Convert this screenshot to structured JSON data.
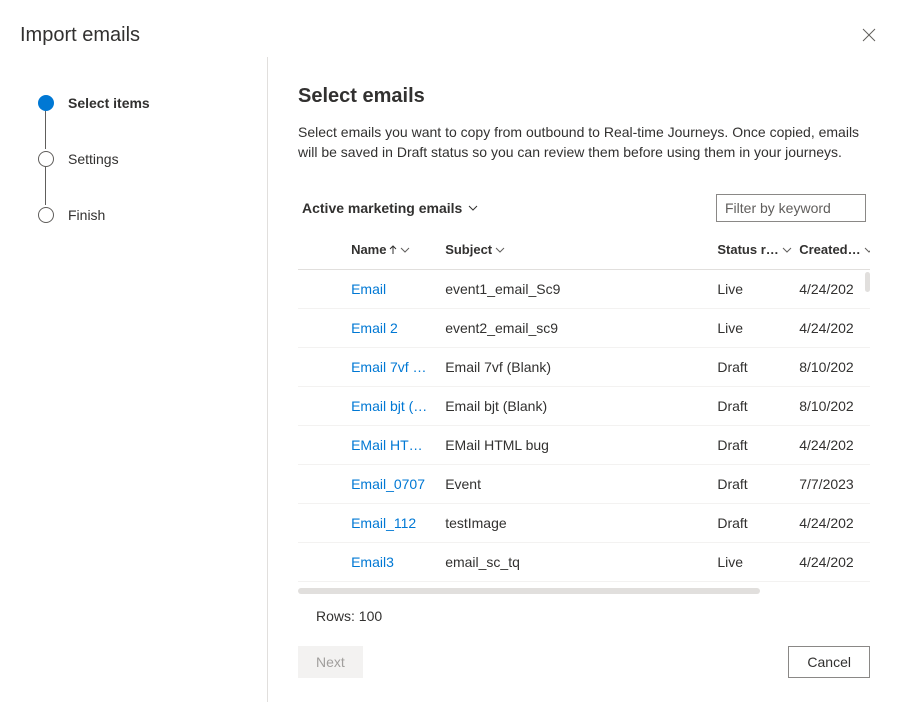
{
  "dialog": {
    "title": "Import emails"
  },
  "steps": {
    "items": [
      {
        "label": "Select items",
        "state": "active"
      },
      {
        "label": "Settings",
        "state": "pending"
      },
      {
        "label": "Finish",
        "state": "pending"
      }
    ]
  },
  "main": {
    "title": "Select emails",
    "description": "Select emails you want to copy from outbound to Real-time Journeys. Once copied, emails will be saved in Draft status so you can review them before using them in your journeys."
  },
  "view": {
    "label": "Active marketing emails"
  },
  "filter": {
    "placeholder": "Filter by keyword"
  },
  "table": {
    "columns": {
      "name": "Name",
      "subject": "Subject",
      "status": "Status r…",
      "created": "Created…"
    },
    "rows": [
      {
        "name": "Email",
        "subject": "event1_email_Sc9",
        "status": "Live",
        "created": "4/24/202"
      },
      {
        "name": "Email 2",
        "subject": "event2_email_sc9",
        "status": "Live",
        "created": "4/24/202"
      },
      {
        "name": "Email 7vf …",
        "subject": "Email 7vf (Blank)",
        "status": "Draft",
        "created": "8/10/202"
      },
      {
        "name": "Email bjt (…",
        "subject": "Email bjt (Blank)",
        "status": "Draft",
        "created": "8/10/202"
      },
      {
        "name": "EMail HT…",
        "subject": "EMail HTML bug",
        "status": "Draft",
        "created": "4/24/202"
      },
      {
        "name": "Email_0707",
        "subject": "Event",
        "status": "Draft",
        "created": "7/7/2023"
      },
      {
        "name": "Email_112",
        "subject": "testImage",
        "status": "Draft",
        "created": "4/24/202"
      },
      {
        "name": "Email3",
        "subject": "email_sc_tq",
        "status": "Live",
        "created": "4/24/202"
      }
    ],
    "rows_count_label": "Rows: 100"
  },
  "footer": {
    "next_label": "Next",
    "cancel_label": "Cancel"
  }
}
